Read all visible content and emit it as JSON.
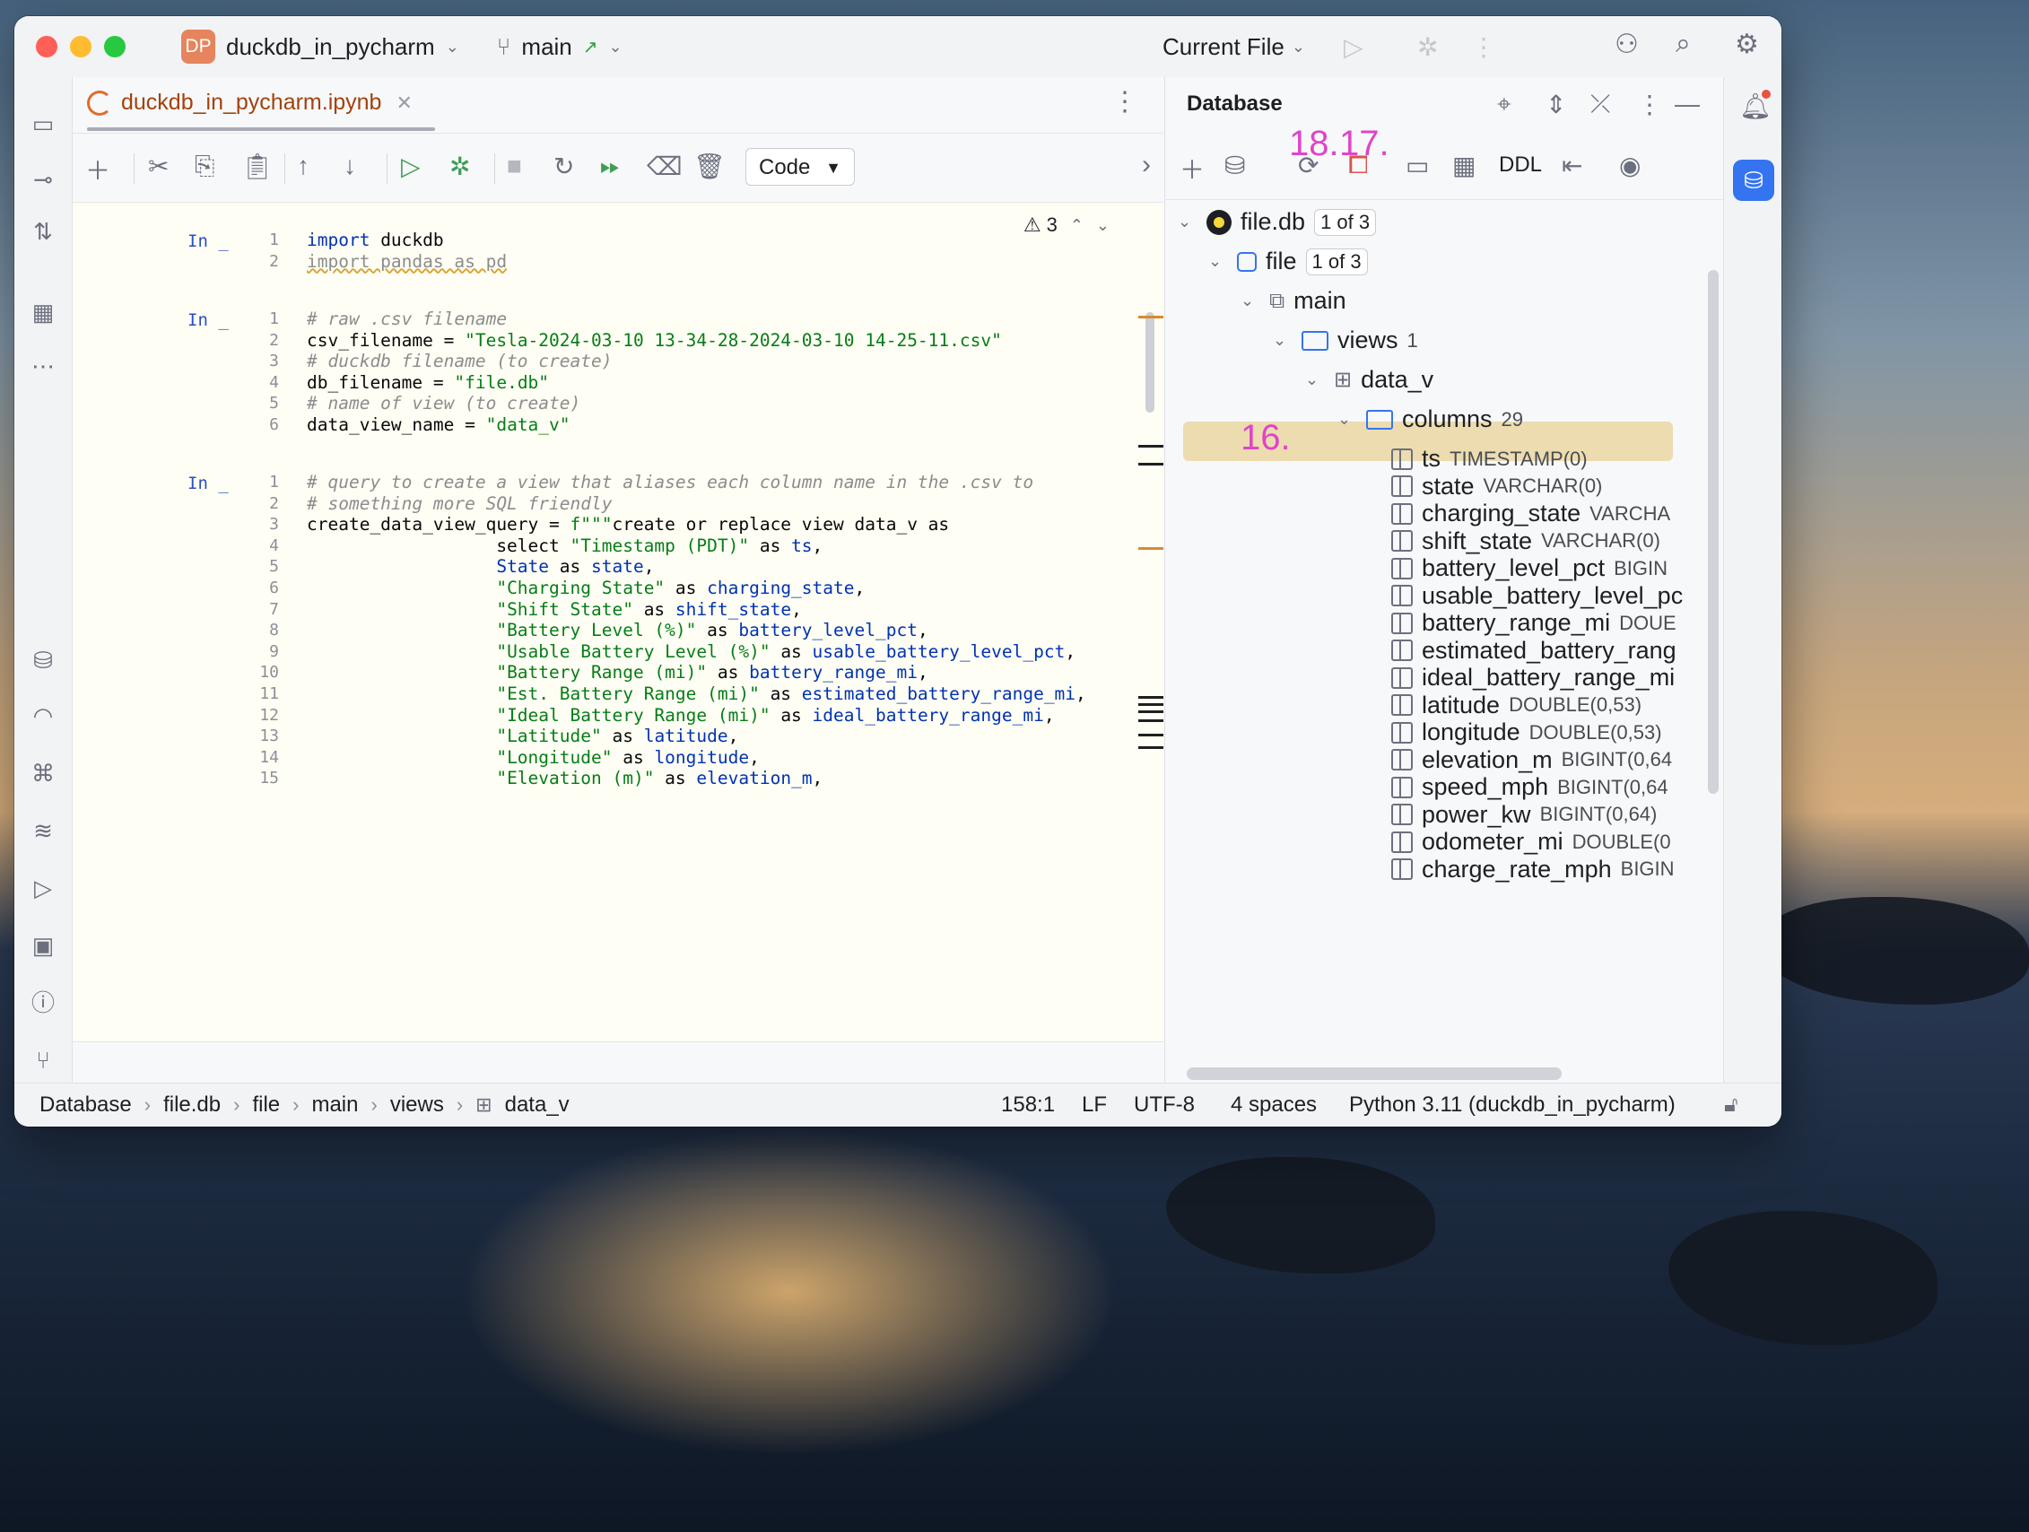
{
  "titlebar": {
    "project_initials": "DP",
    "project_name": "duckdb_in_pycharm",
    "branch": "main",
    "run_config": "Current File"
  },
  "editor": {
    "tab_title": "duckdb_in_pycharm.ipynb",
    "cell_type": "Code",
    "warnings_count": "3",
    "cells": [
      {
        "label": "In _",
        "lines": [
          {
            "n": "1",
            "tokens": [
              {
                "t": "import",
                "c": "kw"
              },
              {
                "t": " duckdb",
                "c": ""
              }
            ]
          },
          {
            "n": "2",
            "tokens": [
              {
                "t": "import pandas as pd",
                "c": "warnline"
              }
            ]
          }
        ]
      },
      {
        "label": "In _",
        "lines": [
          {
            "n": "1",
            "tokens": [
              {
                "t": "# raw .csv filename",
                "c": "cmt"
              }
            ]
          },
          {
            "n": "2",
            "tokens": [
              {
                "t": "csv_filename = ",
                "c": ""
              },
              {
                "t": "\"Tesla-2024-03-10 13-34-28-2024-03-10 14-25-11.csv\"",
                "c": "str"
              }
            ]
          },
          {
            "n": "3",
            "tokens": [
              {
                "t": "# duckdb filename (to create)",
                "c": "cmt"
              }
            ]
          },
          {
            "n": "4",
            "tokens": [
              {
                "t": "db_filename = ",
                "c": ""
              },
              {
                "t": "\"file.db\"",
                "c": "str"
              }
            ]
          },
          {
            "n": "5",
            "tokens": [
              {
                "t": "# name of view (to create)",
                "c": "cmt"
              }
            ]
          },
          {
            "n": "6",
            "tokens": [
              {
                "t": "data_view_name = ",
                "c": ""
              },
              {
                "t": "\"data_v\"",
                "c": "str"
              }
            ]
          }
        ]
      },
      {
        "label": "In _",
        "lines": [
          {
            "n": "1",
            "tokens": [
              {
                "t": "# query to create a view that aliases each column name in the .csv to",
                "c": "cmt"
              }
            ]
          },
          {
            "n": "2",
            "tokens": [
              {
                "t": "# something more SQL friendly",
                "c": "cmt"
              }
            ]
          },
          {
            "n": "3",
            "tokens": [
              {
                "t": "create_data_view_query = ",
                "c": ""
              },
              {
                "t": "f\"\"\"",
                "c": "str"
              },
              {
                "t": "create or replace view data_v as",
                "c": ""
              }
            ]
          },
          {
            "n": "4",
            "tokens": [
              {
                "t": "                  select ",
                "c": ""
              },
              {
                "t": "\"Timestamp (PDT)\"",
                "c": "str"
              },
              {
                "t": " as ",
                "c": ""
              },
              {
                "t": "ts",
                "c": "fstr"
              },
              {
                "t": ",",
                "c": ""
              }
            ]
          },
          {
            "n": "5",
            "tokens": [
              {
                "t": "                  ",
                "c": ""
              },
              {
                "t": "State",
                "c": "fstr"
              },
              {
                "t": " as ",
                "c": ""
              },
              {
                "t": "state",
                "c": "fstr"
              },
              {
                "t": ",",
                "c": ""
              }
            ]
          },
          {
            "n": "6",
            "tokens": [
              {
                "t": "                  ",
                "c": ""
              },
              {
                "t": "\"Charging State\"",
                "c": "str"
              },
              {
                "t": " as ",
                "c": ""
              },
              {
                "t": "charging_state",
                "c": "fstr"
              },
              {
                "t": ",",
                "c": ""
              }
            ]
          },
          {
            "n": "7",
            "tokens": [
              {
                "t": "                  ",
                "c": ""
              },
              {
                "t": "\"Shift State\"",
                "c": "str"
              },
              {
                "t": " as ",
                "c": ""
              },
              {
                "t": "shift_state",
                "c": "fstr"
              },
              {
                "t": ",",
                "c": ""
              }
            ]
          },
          {
            "n": "8",
            "tokens": [
              {
                "t": "                  ",
                "c": ""
              },
              {
                "t": "\"Battery Level (%)\"",
                "c": "str"
              },
              {
                "t": " as ",
                "c": ""
              },
              {
                "t": "battery_level_pct",
                "c": "fstr"
              },
              {
                "t": ",",
                "c": ""
              }
            ]
          },
          {
            "n": "9",
            "tokens": [
              {
                "t": "                  ",
                "c": ""
              },
              {
                "t": "\"Usable Battery Level (%)\"",
                "c": "str"
              },
              {
                "t": " as ",
                "c": ""
              },
              {
                "t": "usable_battery_level_pct",
                "c": "fstr"
              },
              {
                "t": ",",
                "c": ""
              }
            ]
          },
          {
            "n": "10",
            "tokens": [
              {
                "t": "                  ",
                "c": ""
              },
              {
                "t": "\"Battery Range (mi)\"",
                "c": "str"
              },
              {
                "t": " as ",
                "c": ""
              },
              {
                "t": "battery_range_mi",
                "c": "fstr"
              },
              {
                "t": ",",
                "c": ""
              }
            ]
          },
          {
            "n": "11",
            "tokens": [
              {
                "t": "                  ",
                "c": ""
              },
              {
                "t": "\"Est. Battery Range (mi)\"",
                "c": "str"
              },
              {
                "t": " as ",
                "c": ""
              },
              {
                "t": "estimated_battery_range_mi",
                "c": "fstr"
              },
              {
                "t": ",",
                "c": ""
              }
            ]
          },
          {
            "n": "12",
            "tokens": [
              {
                "t": "                  ",
                "c": ""
              },
              {
                "t": "\"Ideal Battery Range (mi)\"",
                "c": "str"
              },
              {
                "t": " as ",
                "c": ""
              },
              {
                "t": "ideal_battery_range_mi",
                "c": "fstr"
              },
              {
                "t": ",",
                "c": ""
              }
            ]
          },
          {
            "n": "13",
            "tokens": [
              {
                "t": "                  ",
                "c": ""
              },
              {
                "t": "\"Latitude\"",
                "c": "str"
              },
              {
                "t": " as ",
                "c": ""
              },
              {
                "t": "latitude",
                "c": "fstr"
              },
              {
                "t": ",",
                "c": ""
              }
            ]
          },
          {
            "n": "14",
            "tokens": [
              {
                "t": "                  ",
                "c": ""
              },
              {
                "t": "\"Longitude\"",
                "c": "str"
              },
              {
                "t": " as ",
                "c": ""
              },
              {
                "t": "longitude",
                "c": "fstr"
              },
              {
                "t": ",",
                "c": ""
              }
            ]
          },
          {
            "n": "15",
            "tokens": [
              {
                "t": "                  ",
                "c": ""
              },
              {
                "t": "\"Elevation (m)\"",
                "c": "str"
              },
              {
                "t": " as ",
                "c": ""
              },
              {
                "t": "elevation_m",
                "c": "fstr"
              },
              {
                "t": ",",
                "c": ""
              }
            ]
          }
        ]
      }
    ]
  },
  "database": {
    "title": "Database",
    "ddl_label": "DDL",
    "annotations": {
      "a18": "18.",
      "a17": "17.",
      "a16": "16."
    },
    "tree": {
      "db_name": "file.db",
      "db_badge": "1 of 3",
      "schema_root": "file",
      "schema_badge": "1 of 3",
      "schema": "main",
      "views_label": "views",
      "views_count": "1",
      "view_name": "data_v",
      "columns_label": "columns",
      "columns_count": "29",
      "columns": [
        {
          "name": "ts",
          "type": "TIMESTAMP(0)"
        },
        {
          "name": "state",
          "type": "VARCHAR(0)"
        },
        {
          "name": "charging_state",
          "type": "VARCHA"
        },
        {
          "name": "shift_state",
          "type": "VARCHAR(0)"
        },
        {
          "name": "battery_level_pct",
          "type": "BIGIN"
        },
        {
          "name": "usable_battery_level_pc",
          "type": ""
        },
        {
          "name": "battery_range_mi",
          "type": "DOUE"
        },
        {
          "name": "estimated_battery_rang",
          "type": ""
        },
        {
          "name": "ideal_battery_range_mi",
          "type": ""
        },
        {
          "name": "latitude",
          "type": "DOUBLE(0,53)"
        },
        {
          "name": "longitude",
          "type": "DOUBLE(0,53)"
        },
        {
          "name": "elevation_m",
          "type": "BIGINT(0,64"
        },
        {
          "name": "speed_mph",
          "type": "BIGINT(0,64"
        },
        {
          "name": "power_kw",
          "type": "BIGINT(0,64)"
        },
        {
          "name": "odometer_mi",
          "type": "DOUBLE(0"
        },
        {
          "name": "charge_rate_mph",
          "type": "BIGIN"
        }
      ]
    }
  },
  "statusbar": {
    "breadcrumb": [
      "Database",
      "file.db",
      "file",
      "main",
      "views",
      "data_v"
    ],
    "position": "158:1",
    "line_ending": "LF",
    "encoding": "UTF-8",
    "indent": "4 spaces",
    "interpreter": "Python 3.11 (duckdb_in_pycharm)"
  }
}
